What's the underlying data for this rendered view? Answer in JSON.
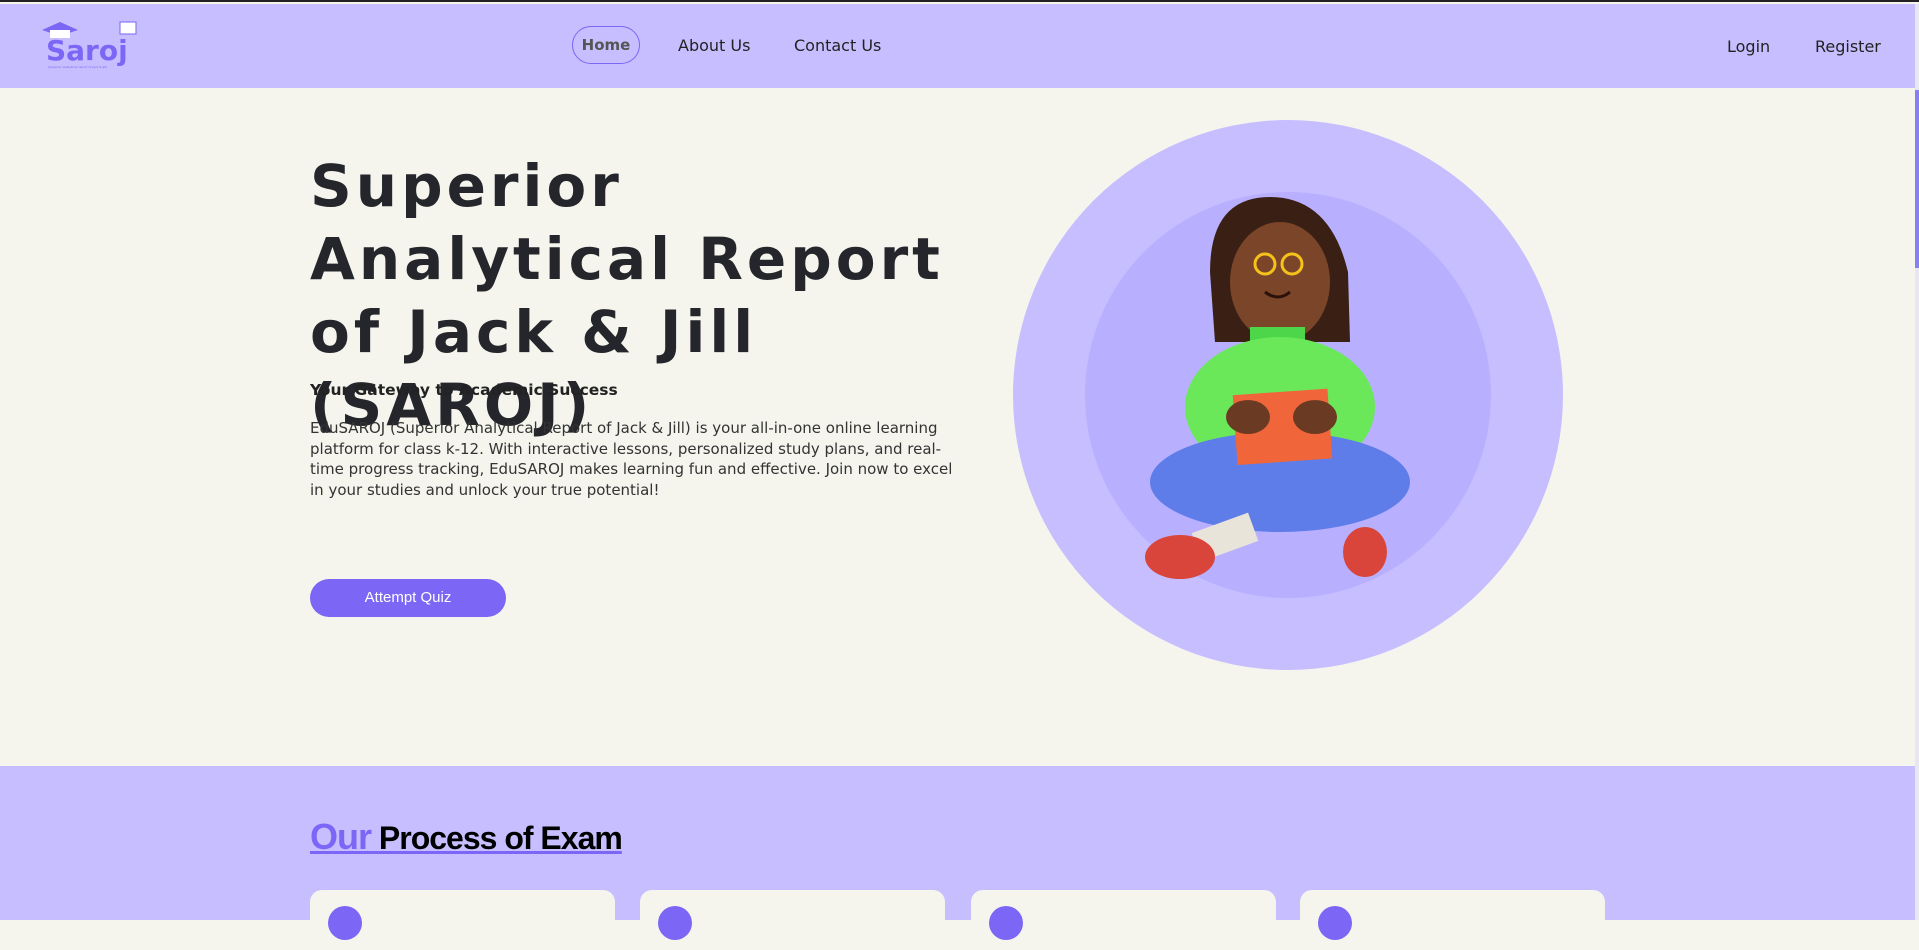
{
  "nav": {
    "logo_text": "Saroj",
    "logo_tagline": "(Superior analytical report of Jack & Jill)",
    "links": [
      "Home",
      "About Us",
      "Contact Us"
    ],
    "login": "Login",
    "register": "Register"
  },
  "hero": {
    "title": "Superior Analytical Report of Jack & Jill (SAROJ)",
    "subtitle": "Your Gateway to Academic Success",
    "description": "EduSAROJ (Superior Analytical Report of Jack & Jill) is your all-in-one online learning platform for class k-12. With interactive lessons, personalized study plans, and real-time progress tracking, EduSAROJ makes learning fun and effective. Join now to excel in your studies and unlock your true potential!",
    "cta": "Attempt Quiz",
    "image": "girl-reading-book-illustration"
  },
  "process": {
    "title_accent": "Our",
    "title_rest": "Process of Exam"
  },
  "colors": {
    "accent": "#7b66f5",
    "nav_bg": "#c6beff",
    "page_bg": "#f5f5ee"
  }
}
